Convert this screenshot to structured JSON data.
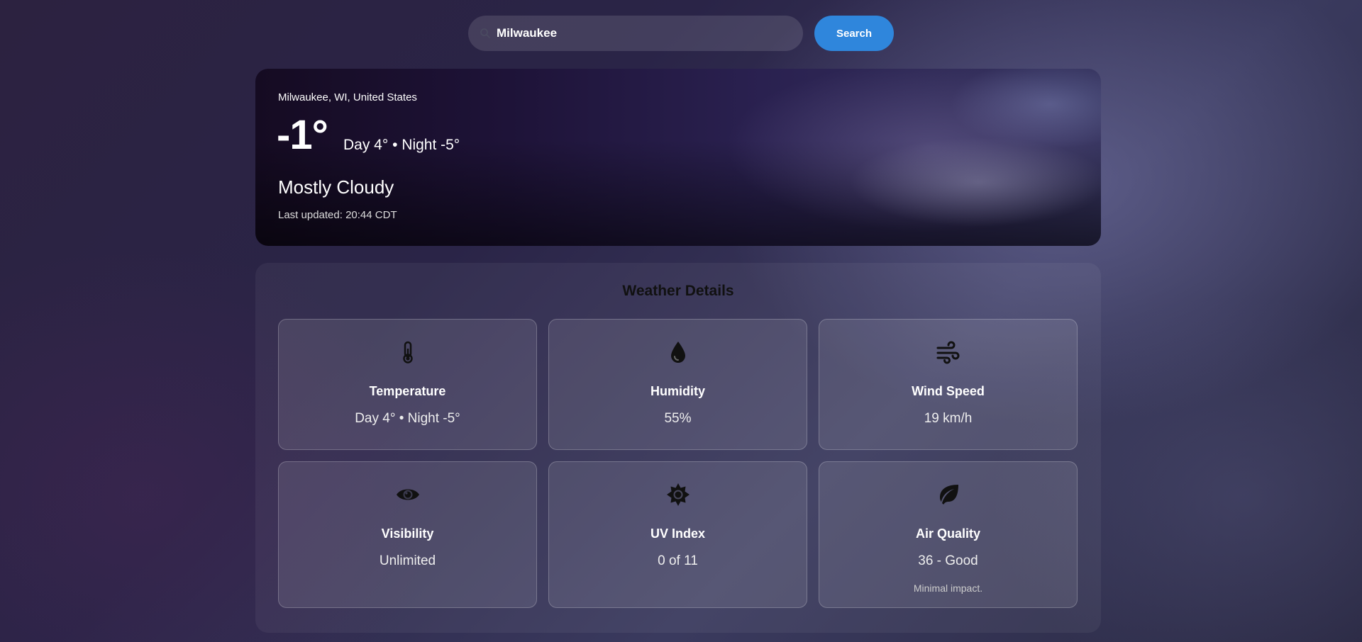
{
  "search": {
    "value": "Milwaukee",
    "button_label": "Search",
    "icon": "search-icon"
  },
  "current": {
    "location": "Milwaukee, WI, United States",
    "temperature": "-1°",
    "day_night": "Day 4° • Night -5°",
    "condition": "Mostly Cloudy",
    "last_updated": "Last updated: 20:44 CDT"
  },
  "details": {
    "title": "Weather Details",
    "cards": [
      {
        "label": "Temperature",
        "value": "Day 4° • Night -5°",
        "icon": "thermometer-icon"
      },
      {
        "label": "Humidity",
        "value": "55%",
        "icon": "droplet-icon"
      },
      {
        "label": "Wind Speed",
        "value": "19 km/h",
        "icon": "wind-icon"
      },
      {
        "label": "Visibility",
        "value": "Unlimited",
        "icon": "eye-icon"
      },
      {
        "label": "UV Index",
        "value": "0 of 11",
        "icon": "sun-icon"
      },
      {
        "label": "Air Quality",
        "value": "36 - Good",
        "note": "Minimal impact.",
        "icon": "leaf-icon"
      }
    ]
  },
  "colors": {
    "accent": "#2f86dc",
    "icon": "#111111"
  }
}
